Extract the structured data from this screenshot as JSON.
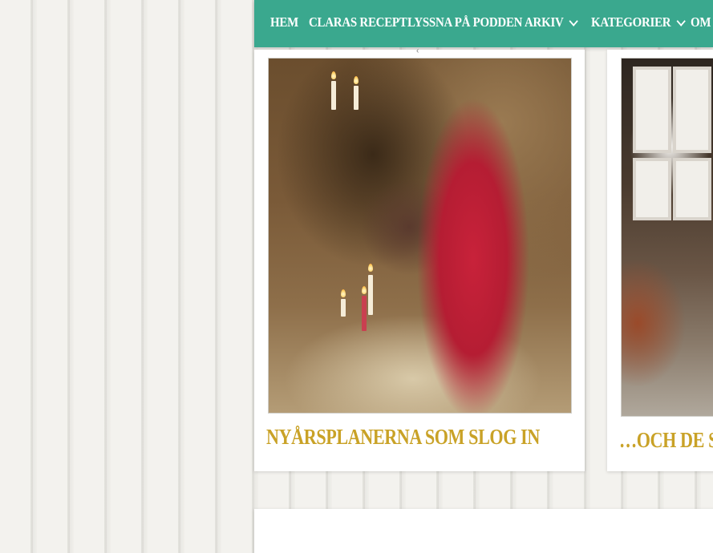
{
  "nav": {
    "items": [
      {
        "label": "HEM"
      },
      {
        "label": "CLARAS RECEPT"
      },
      {
        "label": "LYSSNA PÅ PODDEN"
      },
      {
        "label": "ARKIV"
      },
      {
        "label": "KATEGORIER"
      },
      {
        "label": "OM C"
      }
    ]
  },
  "posts": [
    {
      "title": "NYÅRSPLANERNA SOM SLOG IN"
    },
    {
      "title": "…OCH DE SO"
    }
  ],
  "colors": {
    "nav_bg": "#3aa88e",
    "title": "#c9a227"
  },
  "icons": {
    "dropdown": "chevron-down-icon",
    "arrow": "chevron-left-icon"
  }
}
